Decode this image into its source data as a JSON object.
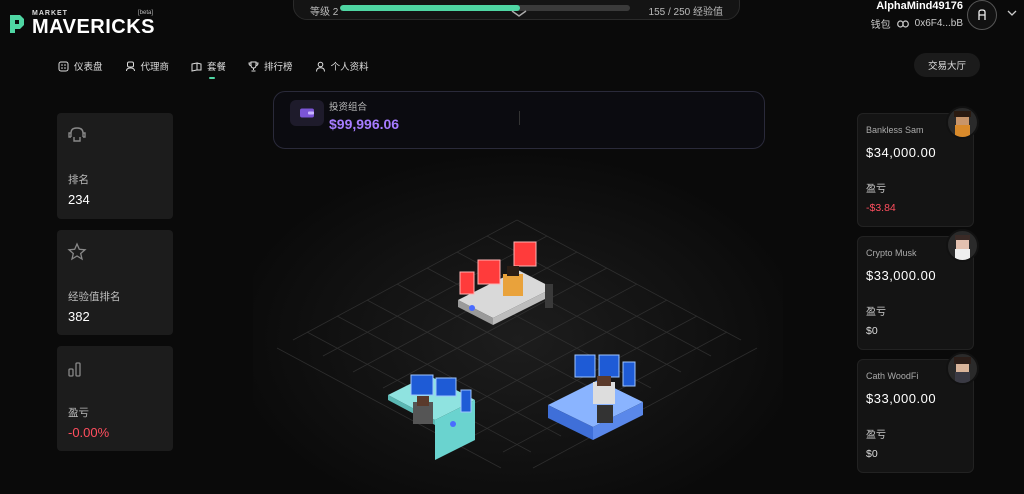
{
  "brand": {
    "small": "MARKET",
    "name": "MAVERICKS",
    "badge": "[beta]"
  },
  "xp": {
    "level_label": "等级 2",
    "progress": 0.62,
    "value_text": "155 / 250 经验值"
  },
  "user": {
    "name": "AlphaMind49176",
    "wallet_label": "钱包",
    "wallet_address": "0x6F4...bB"
  },
  "nav": {
    "items": [
      {
        "label": "仪表盘",
        "icon": "dashboard-icon"
      },
      {
        "label": "代理商",
        "icon": "agent-icon"
      },
      {
        "label": "套餐",
        "icon": "packages-icon",
        "active": true
      },
      {
        "label": "排行榜",
        "icon": "trophy-icon"
      },
      {
        "label": "个人资料",
        "icon": "profile-icon"
      }
    ],
    "trade_button": "交易大厅"
  },
  "stats": [
    {
      "label": "排名",
      "value": "234",
      "icon": "helmet-icon"
    },
    {
      "label": "经验值排名",
      "value": "382",
      "icon": "star-icon"
    },
    {
      "label": "盈亏",
      "value": "-0.00%",
      "icon": "bars-icon",
      "negative": true
    }
  ],
  "portfolio": {
    "label": "投资组合",
    "value": "$99,996.06",
    "icon": "wallet-icon"
  },
  "traders": [
    {
      "name": "Bankless Sam",
      "value": "$34,000.00",
      "pl_label": "盈亏",
      "pl": "-$3.84",
      "negative": true,
      "avatar_color": "#d98a2b"
    },
    {
      "name": "Crypto Musk",
      "value": "$33,000.00",
      "pl_label": "盈亏",
      "pl": "$0",
      "negative": false,
      "avatar_color": "#b7a3a3"
    },
    {
      "name": "Cath WoodFi",
      "value": "$33,000.00",
      "pl_label": "盈亏",
      "pl": "$0",
      "negative": false,
      "avatar_color": "#6b4b3a"
    }
  ],
  "colors": {
    "accent": "#4fd6a3",
    "negative": "#ff4e5e",
    "portfolio_value": "#a77cff"
  }
}
